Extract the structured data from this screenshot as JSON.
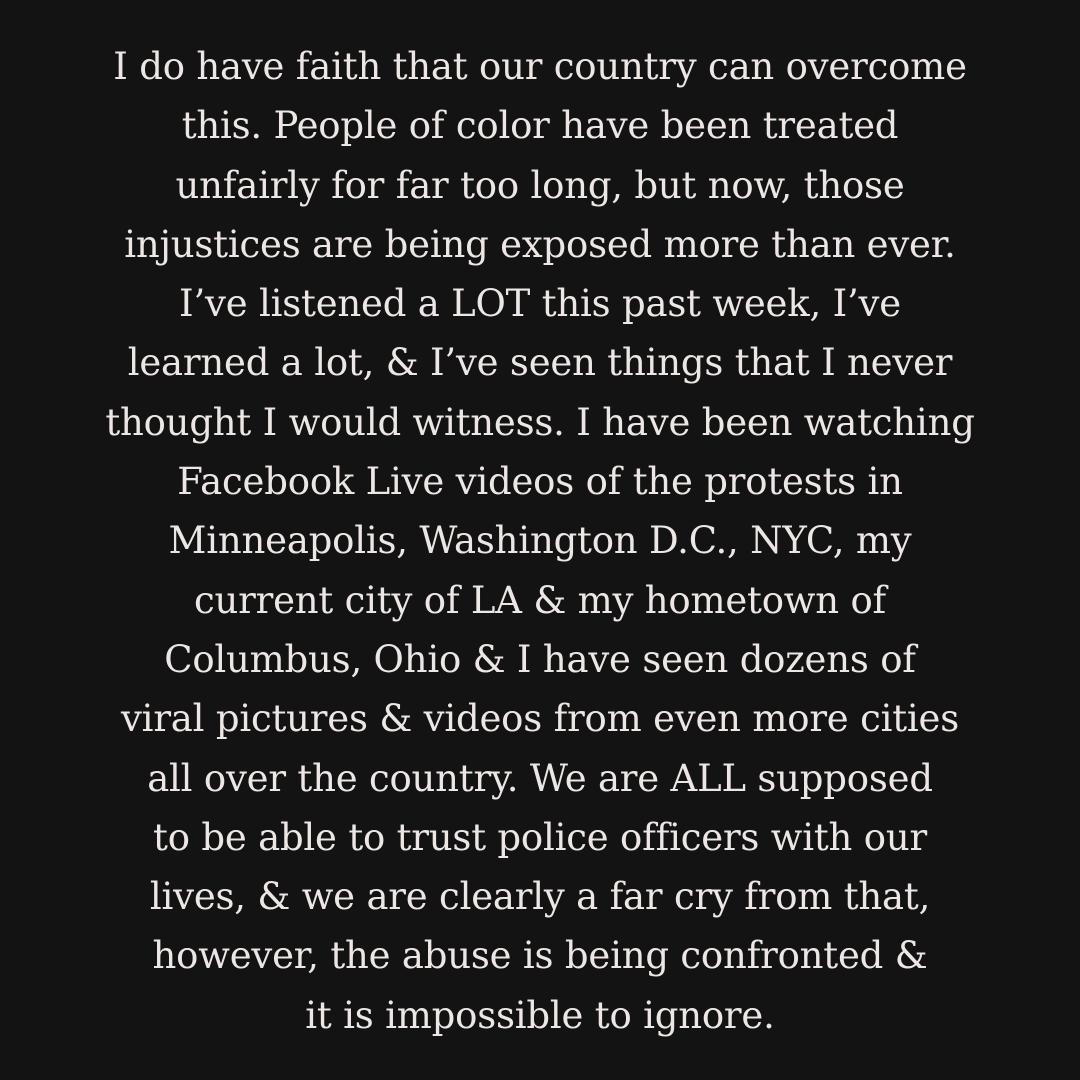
{
  "post": {
    "lines": [
      "I do have faith that our country can overcome",
      "this. People of color have been treated",
      "unfairly for far too long, but now, those",
      "injustices are being exposed more than ever.",
      "I’ve listened a LOT this past week, I’ve",
      "learned a lot, & I’ve seen things that I never",
      "thought I would witness. I have been watching",
      "Facebook Live videos of the protests in",
      "Minneapolis, Washington D.C., NYC, my",
      "current city of LA & my hometown of",
      "Columbus, Ohio & I have seen dozens of",
      "viral pictures & videos from even more cities",
      "all over the country. We are ALL supposed",
      "to be able to trust police officers with our",
      "lives, & we are clearly a far cry from that,",
      "however, the abuse is being confronted &",
      "it is impossible to ignore."
    ]
  },
  "colors": {
    "background": "#141313",
    "text": "#ece6e4"
  }
}
